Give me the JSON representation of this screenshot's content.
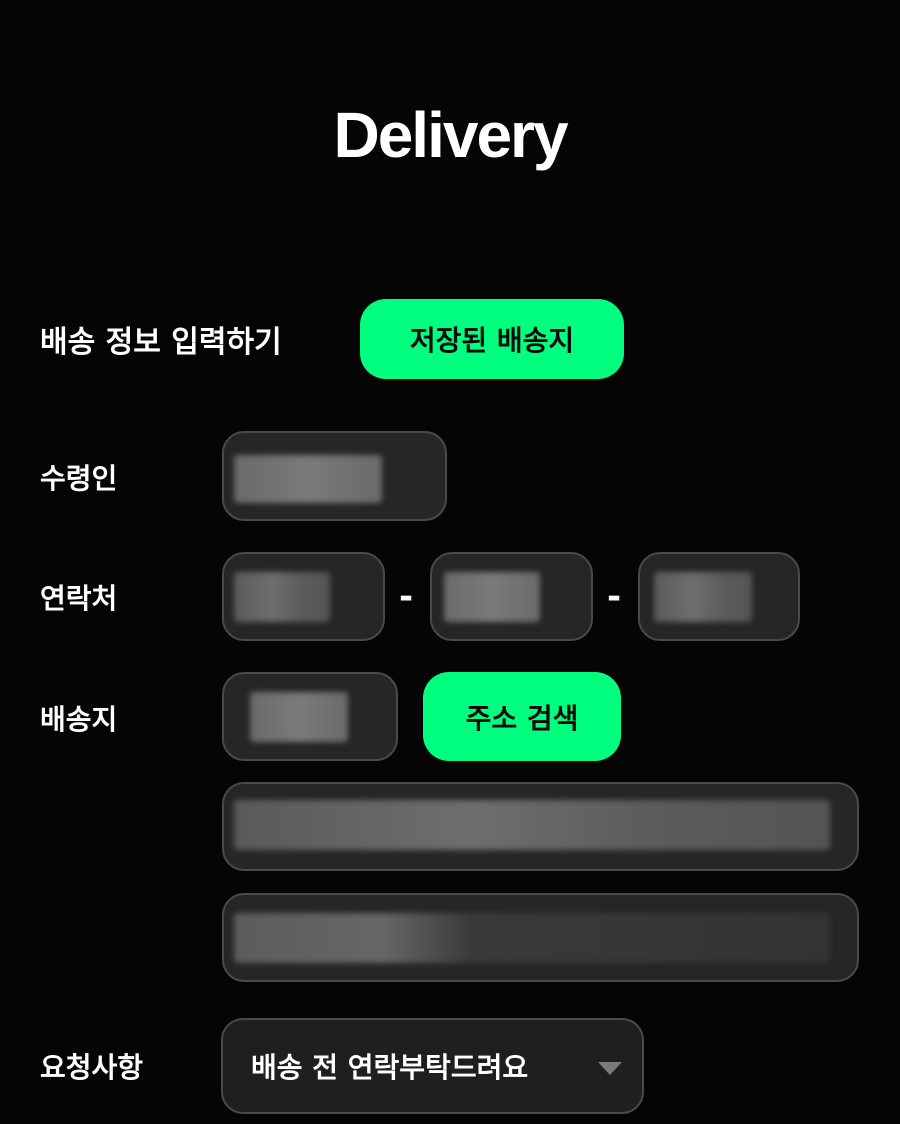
{
  "app": {
    "logo": "Delivery"
  },
  "section": {
    "title": "배송 정보 입력하기",
    "saved_button": "저장된 배송지"
  },
  "form": {
    "recipient_label": "수령인",
    "contact_label": "연락처",
    "contact_separator": "-",
    "address_label": "배송지",
    "search_button": "주소 검색",
    "request_label": "요청사항",
    "request_selected": "배송 전 연락부탁드려요"
  },
  "colors": {
    "accent": "#00ff7f",
    "background": "#050505",
    "field_bg": "#262626",
    "field_border": "#4a4a4a"
  }
}
